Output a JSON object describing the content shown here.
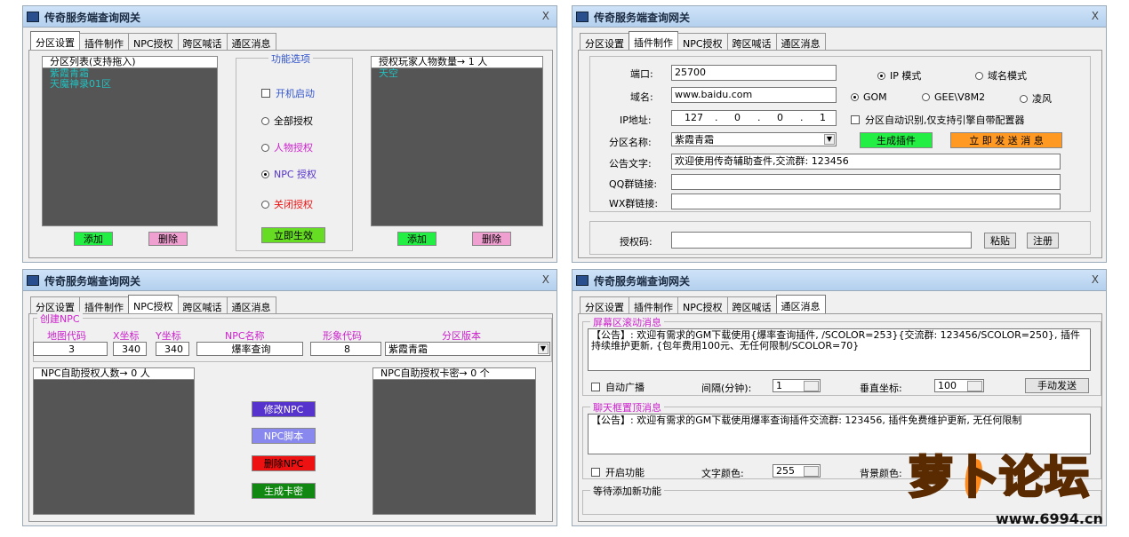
{
  "window_title": "传奇服务端查询网关",
  "close_glyph": "X",
  "tabs": [
    "分区设置",
    "插件制作",
    "NPC授权",
    "跨区喊话",
    "通区消息"
  ],
  "p1": {
    "list_left": {
      "header": "分区列表(支持拖入)",
      "items": [
        "紫霞青霜",
        "天魔神录01区"
      ]
    },
    "add": "添加",
    "del": "删除",
    "options_title": "功能选项",
    "autostart": "开机启动",
    "radios": [
      "全部授权",
      "人物授权",
      "NPC 授权",
      "关闭授权"
    ],
    "apply": "立即生效",
    "list_right": {
      "header": "授权玩家人物数量→ 1 人",
      "items": [
        "天空"
      ]
    },
    "add2": "添加",
    "del2": "删除"
  },
  "p2": {
    "port_label": "端口:",
    "port": "25700",
    "ip_mode": "IP 模式",
    "domain_mode": "域名模式",
    "domain_label": "域名:",
    "domain": "www.baidu.com",
    "gom": "GOM",
    "gee": "GEE\\V8M2",
    "lf": "凌风",
    "ip_label": "IP地址:",
    "ip": [
      "127",
      "0",
      "0",
      "1"
    ],
    "auto_check": "分区自动识别,仅支持引擎自带配置器",
    "zone_label": "分区名称:",
    "zone": "紫霞青霜",
    "gen": "生成插件",
    "send": "立 即 发 送 消 息",
    "notice_label": "公告文字:",
    "notice": "欢迎使用传奇辅助查件,交流群: 123456",
    "qq_label": "QQ群链接:",
    "wx_label": "WX群链接:",
    "auth_label": "授权码:",
    "paste": "粘贴",
    "register": "注册"
  },
  "p3": {
    "group_title": "创建NPC",
    "cols": [
      "地图代码",
      "X坐标",
      "Y坐标",
      "NPC名称",
      "形象代码",
      "分区版本"
    ],
    "vals": [
      "3",
      "340",
      "340",
      "爆率查询",
      "8",
      "紫霞青霜"
    ],
    "left_header": "NPC自助授权人数→ 0 人",
    "right_header": "NPC自助授权卡密→ 0 个",
    "btns": [
      "修改NPC",
      "NPC脚本",
      "删除NPC",
      "生成卡密"
    ]
  },
  "p4": {
    "scroll_title": "屏幕区滚动消息",
    "scroll_text": "【公告】: 欢迎有需求的GM下载使用{爆率查询插件, /SCOLOR=253}{交流群: 123456/SCOLOR=250}, 插件持续维护更新, {包年费用100元、无任何限制/SCOLOR=70}",
    "auto_bc": "自动广播",
    "interval_label": "间隔(分钟):",
    "interval": "1",
    "vert_label": "垂直坐标:",
    "vert": "100",
    "manual": "手动发送",
    "chat_title": "聊天框置顶消息",
    "chat_text": "【公告】: 欢迎有需求的GM下载使用爆率查询插件交流群: 123456, 插件免费维护更新, 无任何限制",
    "open_func": "开启功能",
    "fg_label": "文字颜色:",
    "fg": "255",
    "bg_label": "背景颜色:",
    "pending": "等待添加新功能"
  },
  "watermark": {
    "brand": "萝卜论坛",
    "site": "www.6994.cn"
  },
  "colors": {
    "green": "#22ee44",
    "pink": "#f0a0d0",
    "orange": "#ff9922",
    "purple": "#5533cc",
    "lavender": "#8888ee",
    "red": "#ee1111",
    "darkgreen": "#118811",
    "list_bg": "#555555",
    "cyan": "#22c0c0"
  }
}
